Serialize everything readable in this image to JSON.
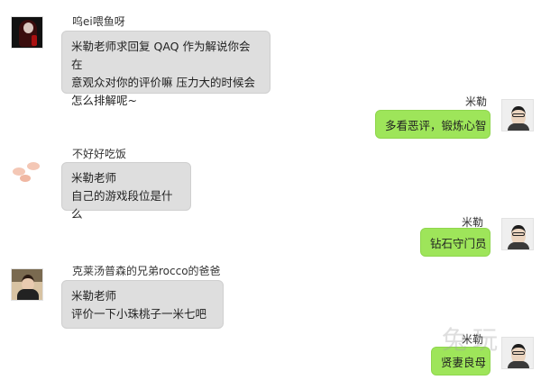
{
  "messages": [
    {
      "sender": "呜ei喂鱼呀",
      "side": "left",
      "lines": [
        "米勒老师求回复 QAQ 作为解说你会在",
        "意观众对你的评价嘛   压力大的时候会",
        "怎么排解呢~"
      ]
    },
    {
      "sender": "米勒",
      "side": "right",
      "lines": [
        "多看恶评，锻炼心智"
      ]
    },
    {
      "sender": "不好好吃饭",
      "side": "left",
      "lines": [
        "米勒老师",
        "自己的游戏段位是什么"
      ]
    },
    {
      "sender": "米勒",
      "side": "right",
      "lines": [
        "钻石守门员"
      ]
    },
    {
      "sender": "克莱汤普森的兄弟rocco的爸爸",
      "side": "left",
      "lines": [
        "米勒老师",
        "评价一下小珠桃子一米七吧"
      ]
    },
    {
      "sender": "米勒",
      "side": "right",
      "lines": [
        "贤妻良母"
      ]
    }
  ],
  "watermark": "兔玩",
  "colors": {
    "incoming_bubble": "#dedede",
    "outgoing_bubble": "#9ee55a",
    "background": "#ffffff"
  }
}
